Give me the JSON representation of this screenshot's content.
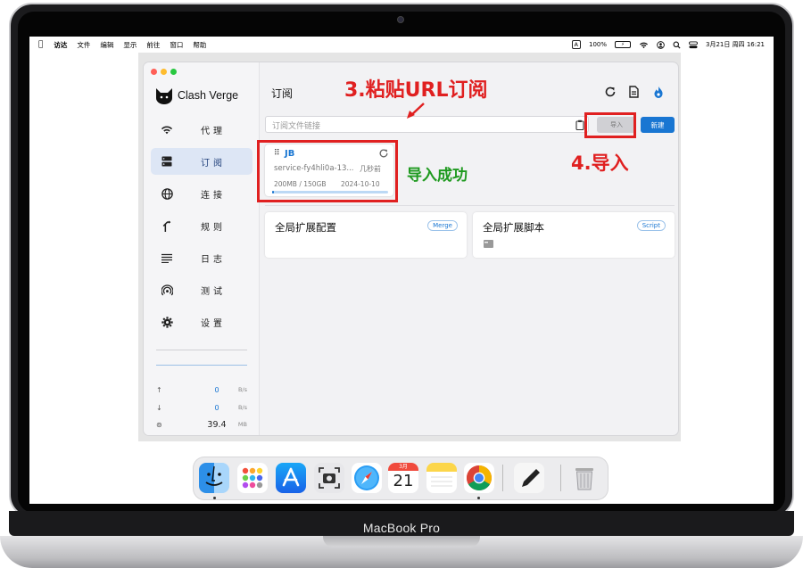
{
  "menubar": {
    "left": [
      "访达",
      "文件",
      "编辑",
      "显示",
      "前往",
      "窗口",
      "帮助"
    ],
    "input_method": "A",
    "battery": "100%",
    "datetime": "3月21日 周四  16:21"
  },
  "app": {
    "name": "Clash Verge",
    "nav": [
      {
        "label": "代理",
        "icon": "wifi-icon"
      },
      {
        "label": "订阅",
        "icon": "server-icon",
        "active": true
      },
      {
        "label": "连接",
        "icon": "globe-icon"
      },
      {
        "label": "规则",
        "icon": "fork-icon"
      },
      {
        "label": "日志",
        "icon": "list-icon"
      },
      {
        "label": "测试",
        "icon": "broadcast-icon"
      },
      {
        "label": "设置",
        "icon": "gear-icon"
      }
    ],
    "traffic": {
      "up": {
        "value": "0",
        "unit": "B/s"
      },
      "down": {
        "value": "0",
        "unit": "B/s"
      },
      "memory": {
        "value": "39.4",
        "unit": "MB"
      }
    }
  },
  "main": {
    "title": "订阅",
    "url_placeholder": "订阅文件链接",
    "import_label": "导入",
    "new_label": "新建",
    "profile": {
      "name": "JB",
      "url": "service-fy4hli0a-13...",
      "updated": "几秒前",
      "usage": "200MB / 150GB",
      "expire": "2024-10-10",
      "usage_fraction": 0.0013
    },
    "cards": [
      {
        "title": "全局扩展配置",
        "badge": "Merge"
      },
      {
        "title": "全局扩展脚本",
        "badge": "Script"
      }
    ]
  },
  "annotations": {
    "step3": "3.粘贴URL订阅",
    "step4": "4.导入",
    "success": "导入成功"
  },
  "dock": {
    "calendar_month": "3月",
    "calendar_day": "21"
  },
  "laptop_label": "MacBook Pro",
  "colors": {
    "accent": "#1976d2",
    "annotation_red": "#e02020",
    "annotation_green": "#1f9a1f"
  }
}
